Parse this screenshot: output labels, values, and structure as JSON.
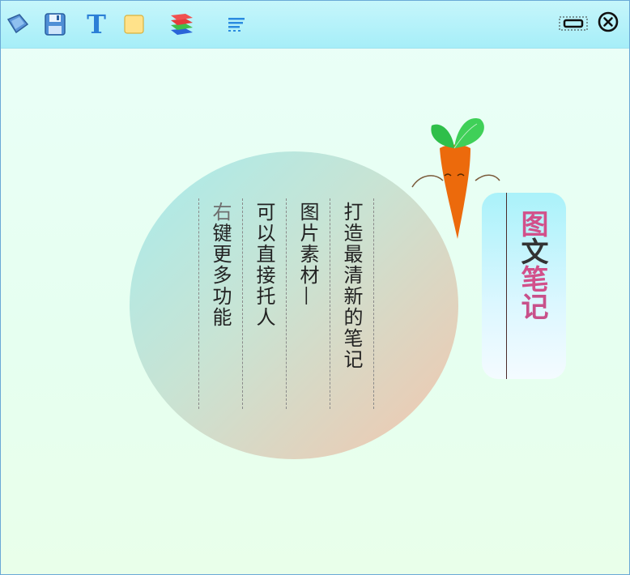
{
  "toolbar": {
    "icons": [
      "bookmark-icon",
      "save-icon",
      "text-icon",
      "sticky-note-icon",
      "layers-icon",
      "align-icon"
    ],
    "text_button_glyph": "T",
    "colors": {
      "background": "#a6eef8",
      "accent": "#2b7fd6"
    }
  },
  "window_controls": {
    "icons": [
      "minimize-icon",
      "close-icon"
    ]
  },
  "note": {
    "columns": [
      {
        "text": "打造最清新的笔记",
        "color": "#222222"
      },
      {
        "text": "图片素材—",
        "color": "#222222"
      },
      {
        "text": "可以直接托人",
        "color": "#222222"
      },
      {
        "text": "键更多功能",
        "prefix": "右",
        "prefix_color": "#6f6f6f",
        "color": "#222222"
      }
    ],
    "circle_colors": [
      "#a8ecec",
      "#f3c6ad"
    ]
  },
  "tag": {
    "chars": [
      "图",
      "文",
      "笔",
      "记"
    ],
    "colors": [
      "#d2508a",
      "#333333",
      "#d2508a",
      "#d2508a"
    ]
  },
  "mascot": "carrot-icon"
}
